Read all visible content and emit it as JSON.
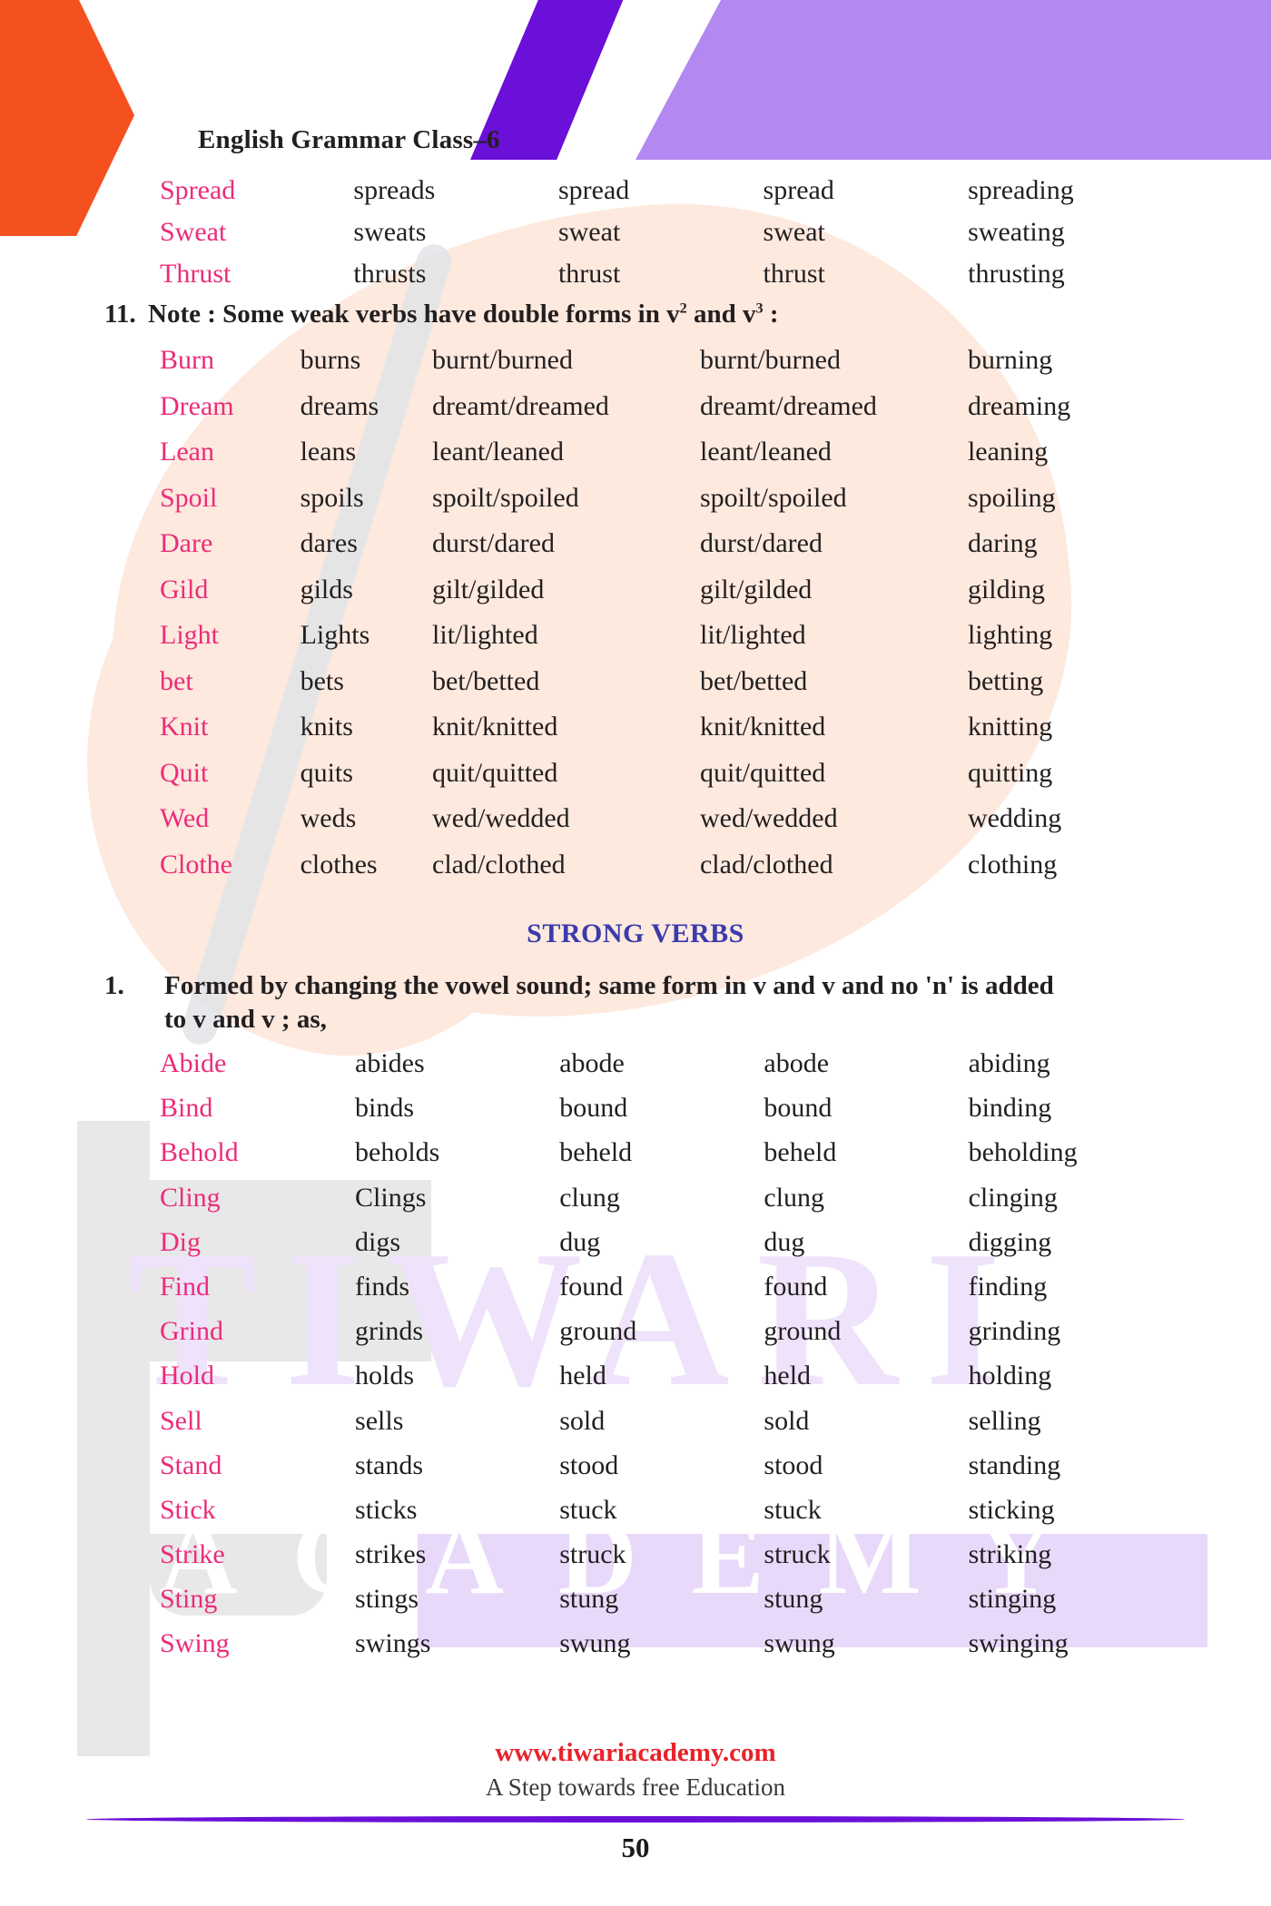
{
  "header": {
    "title": "English Grammar Class–6"
  },
  "top_table": {
    "rows": [
      [
        "Spread",
        "spreads",
        "spread",
        "spread",
        "spreading"
      ],
      [
        "Sweat",
        "sweats",
        "sweat",
        "sweat",
        "sweating"
      ],
      [
        "Thrust",
        "thrusts",
        "thrust",
        "thrust",
        "thrusting"
      ]
    ]
  },
  "note": {
    "number": "11.",
    "text_before": "Note  : Some weak verbs have double forms in v",
    "sup1": "2",
    "text_mid": " and v",
    "sup2": "3",
    "text_after": " :"
  },
  "weak_double_table": {
    "rows": [
      [
        "Burn",
        "burns",
        "burnt/burned",
        "burnt/burned",
        "burning"
      ],
      [
        "Dream",
        "dreams",
        "dreamt/dreamed",
        "dreamt/dreamed",
        "dreaming"
      ],
      [
        "Lean",
        "leans",
        "leant/leaned",
        "leant/leaned",
        "leaning"
      ],
      [
        "Spoil",
        "spoils",
        "spoilt/spoiled",
        "spoilt/spoiled",
        "spoiling"
      ],
      [
        "Dare",
        "dares",
        "durst/dared",
        "durst/dared",
        "daring"
      ],
      [
        "Gild",
        "gilds",
        "gilt/gilded",
        "gilt/gilded",
        "gilding"
      ],
      [
        "Light",
        "Lights",
        "lit/lighted",
        "lit/lighted",
        "lighting"
      ],
      [
        "bet",
        "bets",
        "bet/betted",
        "bet/betted",
        "betting"
      ],
      [
        "Knit",
        "knits",
        "knit/knitted",
        "knit/knitted",
        "knitting"
      ],
      [
        "Quit",
        "quits",
        "quit/quitted",
        "quit/quitted",
        "quitting"
      ],
      [
        "Wed",
        "weds",
        "wed/wedded",
        "wed/wedded",
        "wedding"
      ],
      [
        "Clothe",
        "clothes",
        "clad/clothed",
        "clad/clothed",
        "clothing"
      ]
    ]
  },
  "section": {
    "title": "STRONG VERBS"
  },
  "rule1": {
    "number": "1.",
    "line1": "Formed by changing the vowel sound; same form in v and v and no 'n' is added",
    "line2": "to v and v ; as,"
  },
  "strong_table": {
    "rows": [
      [
        "Abide",
        "abides",
        "abode",
        "abode",
        "abiding"
      ],
      [
        "Bind",
        "binds",
        "bound",
        "bound",
        "binding"
      ],
      [
        "Behold",
        "beholds",
        "beheld",
        "beheld",
        "beholding"
      ],
      [
        "Cling",
        "Clings",
        "clung",
        "clung",
        "clinging"
      ],
      [
        "Dig",
        "digs",
        "dug",
        "dug",
        "digging"
      ],
      [
        "Find",
        "finds",
        "found",
        "found",
        "finding"
      ],
      [
        "Grind",
        "grinds",
        "ground",
        "ground",
        "grinding"
      ],
      [
        "Hold",
        "holds",
        "held",
        "held",
        "holding"
      ],
      [
        "Sell",
        "sells",
        "sold",
        "sold",
        "selling"
      ],
      [
        "Stand",
        "stands",
        "stood",
        "stood",
        "standing"
      ],
      [
        "Stick",
        "sticks",
        "stuck",
        "stuck",
        "sticking"
      ],
      [
        "Strike",
        "strikes",
        "struck",
        "struck",
        "striking"
      ],
      [
        "Sting",
        "stings",
        "stung",
        "stung",
        "stinging"
      ],
      [
        "Swing",
        "swings",
        "swung",
        "swung",
        "swinging"
      ]
    ]
  },
  "watermark": {
    "line1": "TIWARI",
    "line2": "ACADEMY"
  },
  "footer": {
    "site": "www.tiwariacademy.com",
    "tagline": "A Step towards free Education",
    "page_number": "50"
  },
  "colors": {
    "verb_pink": "#ec2c7a",
    "section_blue": "#3b3bad",
    "footer_red": "#e8222a",
    "accent_violet": "#6a10d8",
    "accent_lilac": "#b388f0",
    "accent_orange": "#f4511e",
    "peach_tint": "#fde9de"
  }
}
